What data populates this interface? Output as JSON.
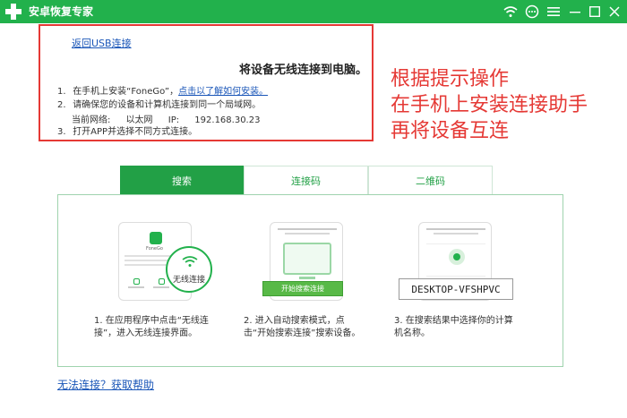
{
  "app": {
    "title": "安卓恢复专家"
  },
  "titlebar": {
    "icons": [
      "wifi-icon",
      "chat-icon",
      "menu-icon",
      "minimize-icon",
      "maximize-icon",
      "close-icon"
    ],
    "color": "#22b14c"
  },
  "instructions": {
    "back_link": "返回USB连接",
    "title": "将设备无线连接到电脑。",
    "steps": [
      {
        "num": "1.",
        "text": "在手机上安装“FoneGo”，",
        "link": "点击以了解如何安装。"
      },
      {
        "num": "2.",
        "text": "请确保您的设备和计算机连接到同一个局域网。"
      },
      {
        "num": "3.",
        "text": "打开APP并选择不同方式连接。"
      }
    ],
    "network": {
      "label": "当前网络:",
      "type": "以太网",
      "ip_label": "IP:",
      "ip": "192.168.30.23"
    }
  },
  "annotation": {
    "lines": [
      "根据提示操作",
      "在手机上安装连接助手",
      "再将设备互连"
    ],
    "color": "#e53935"
  },
  "tabs": [
    {
      "label": "搜索",
      "active": true
    },
    {
      "label": "连接码",
      "active": false
    },
    {
      "label": "二维码",
      "active": false
    }
  ],
  "cards": [
    {
      "caption_1": "1.  在应用程序中点击“无线连",
      "caption_2": "接”，进入无线连接界面。",
      "app_name": "FoneGo",
      "wireless_label": "无线连接"
    },
    {
      "caption_1": "2.  进入自动搜索模式，点",
      "caption_2": "击“开始搜索连接”搜索设备。",
      "button_label": "开始搜索连接"
    },
    {
      "caption_1": "3.  在搜索结果中选择你的计算",
      "caption_2": "机名称。",
      "device_name": "DESKTOP-VFSHPVC"
    }
  ],
  "help_link": "无法连接？获取帮助",
  "colors": {
    "accent": "#22a046",
    "link": "#1a56b8"
  }
}
